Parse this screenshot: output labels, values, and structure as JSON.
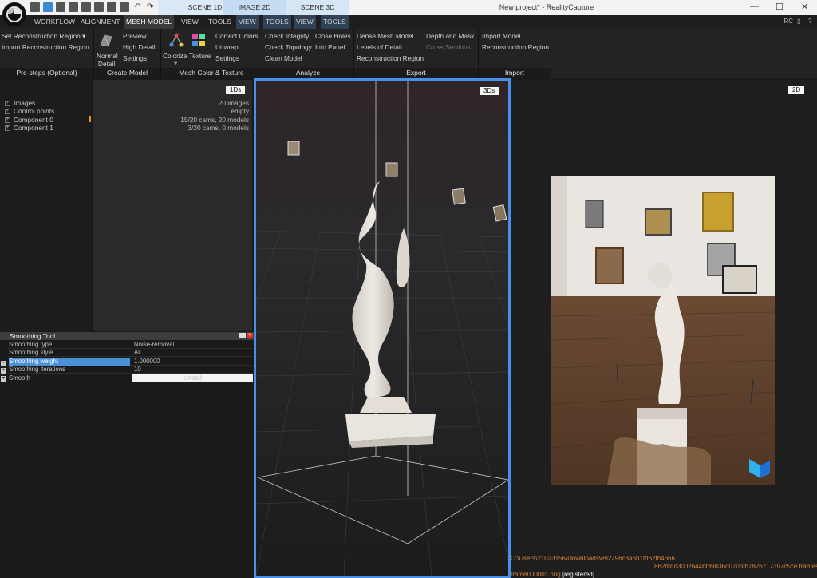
{
  "title_bar": {
    "tabs": [
      "SCENE 1D",
      "IMAGE 2D",
      "SCENE 3D"
    ],
    "window_title": "New project* - RealityCapture"
  },
  "menu": {
    "items": [
      "WORKFLOW",
      "ALIGNMENT",
      "MESH MODEL",
      "VIEW",
      "TOOLS",
      "VIEW",
      "TOOLS",
      "VIEW",
      "TOOLS"
    ],
    "user_label": "RC"
  },
  "ribbon": {
    "presteps": {
      "label": "Pre-steps (Optional)",
      "set_region": "Set Reconstruction Region",
      "import_region": "Import Reconstruction Region"
    },
    "create_model": {
      "label": "Create Model",
      "normal": "Normal",
      "detail": "Detail",
      "preview": "Preview",
      "high_detail": "High Detail",
      "settings": "Settings"
    },
    "color_texture": {
      "label": "Mesh Color & Texture",
      "colorize": "Colorize",
      "texture": "Texture",
      "correct_colors": "Correct Colors",
      "unwrap": "Unwrap",
      "settings": "Settings"
    },
    "analyze": {
      "label": "Analyze",
      "check_integrity": "Check Integrity",
      "check_topology": "Check Topology",
      "clean_model": "Clean Model",
      "close_holes": "Close Holes",
      "info_panel": "Info Panel"
    },
    "export": {
      "label": "Export",
      "dense_mesh": "Dense Mesh Model",
      "levels_of_detail": "Levels of Detail",
      "reconstruction_region": "Reconstruction Region",
      "depth_mask": "Depth and Mask",
      "cross_sections": "Cross Sections"
    },
    "import": {
      "label": "Import",
      "import_model": "Import Model",
      "reconstruction_region": "Reconstruction Region"
    }
  },
  "tree": {
    "items": [
      "Images",
      "Control points",
      "Component 0",
      "Component 1"
    ],
    "values": [
      "20 images",
      "empty",
      "15/20 cams, 20 models",
      "3/20 cams, 0 models"
    ],
    "badge": "1Ds"
  },
  "view3d": {
    "badge": "3Ds"
  },
  "view2d": {
    "badge": "2D",
    "path_line1": "C:\\Users\\21023156\\Downloads\\e92296c3a6b1fd62fb4666",
    "path_line2": "862dfdd3002644bf39836d070bfb7826717397c5ce frames\\",
    "frame_name": "frame000001.png",
    "frame_status": "[registered]"
  },
  "smoothing_tool": {
    "title": "Smoothing Tool",
    "rows": [
      {
        "name": "Smoothing type",
        "value": "Noise-removal"
      },
      {
        "name": "Smoothing style",
        "value": "All"
      },
      {
        "name": "Smoothing weight",
        "value": "1.000000"
      },
      {
        "name": "Smoothing iterations",
        "value": "10"
      },
      {
        "name": "Smooth",
        "value": "smooth"
      }
    ]
  }
}
